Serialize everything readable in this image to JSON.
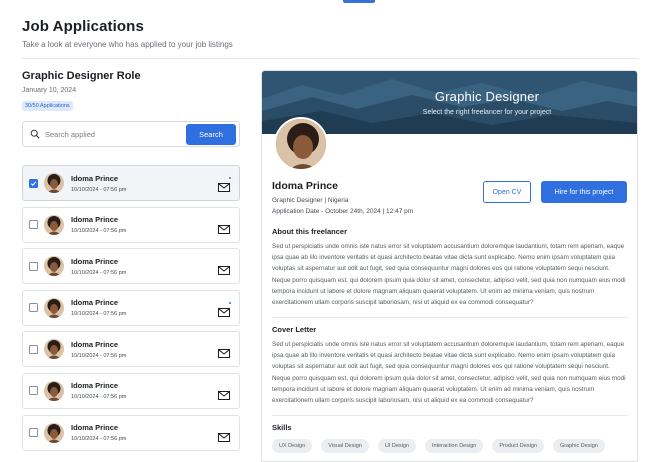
{
  "header": {
    "title": "Job Applications",
    "subtitle": "Take a look at everyone who has applied to your job listings"
  },
  "role": {
    "title": "Graphic Designer Role",
    "date": "January 10, 2024",
    "badge": "30/50 Applications"
  },
  "search": {
    "placeholder": "Search applied",
    "button_label": "Search",
    "icon": "search-icon"
  },
  "applicants": [
    {
      "name": "Idoma Prince",
      "date": "10/10/2024 - 07:56 pm",
      "checked": true,
      "unread": true,
      "selected": true
    },
    {
      "name": "Idoma Prince",
      "date": "10/10/2024 - 07:56 pm",
      "checked": false,
      "unread": false,
      "selected": false
    },
    {
      "name": "Idoma Prince",
      "date": "10/10/2024 - 07:56 pm",
      "checked": false,
      "unread": false,
      "selected": false
    },
    {
      "name": "Idoma Prince",
      "date": "10/10/2024 - 07:56 pm",
      "checked": false,
      "unread": true,
      "selected": false
    },
    {
      "name": "Idoma Prince",
      "date": "10/10/2024 - 07:56 pm",
      "checked": false,
      "unread": false,
      "selected": false
    },
    {
      "name": "Idoma Prince",
      "date": "10/10/2024 - 07:56 pm",
      "checked": false,
      "unread": false,
      "selected": false
    },
    {
      "name": "Idoma Prince",
      "date": "10/10/2024 - 07:56 pm",
      "checked": false,
      "unread": false,
      "selected": false
    }
  ],
  "detail": {
    "banner_title": "Graphic Designer",
    "banner_subtitle": "Select the right freelancer for your project",
    "name": "Idoma Prince",
    "role_location": "Graphic Designer | Nigeria",
    "application_date": "Application Date - October 24th, 2024 | 12:47 pm",
    "open_cv_label": "Open CV",
    "hire_label": "Hire for this project",
    "about_heading": "About this freelancer",
    "about_text": "Sed ut perspiciatis unde omnis iste natus error sit voluptatem accusantium doloremque laudantium, totam rem aperiam, eaque ipsa quae ab illo inventore veritatis et quasi architecto beatae vitae dicta sunt explicabo. Nemo enim ipsam voluptatem quia voluptas sit aspernatur aut odit aut fugit, sed quia consequuntur magni dolores eos qui ratione voluptatem sequi nesciunt. Neque porro quisquam est, qui dolorem ipsum quia dolor sit amet, consectetur, adipisci velit, sed quia non numquam eius modi tempora incidunt ut labore et dolore magnam aliquam quaerat voluptatem. Ut enim ad minima veniam, quis nostrum exercitationem ullam corporis suscipit laboriosam, nisi ut aliquid ex ea commodi consequatur?",
    "cover_heading": "Cover Letter",
    "cover_text": "Sed ut perspiciatis unde omnis iste natus error sit voluptatem accusantium doloremque laudantium, totam rem aperiam, eaque ipsa quae ab illo inventore veritatis et quasi architecto beatae vitae dicta sunt explicabo. Nemo enim ipsam voluptatem quia voluptas sit aspernatur aut odit aut fugit, sed quia consequuntur magni dolores eos qui ratione voluptatem sequi nesciunt. Neque porro quisquam est, qui dolorem ipsum quia dolor sit amet, consectetur, adipisci velit, sed quia non numquam eius modi tempora incidunt ut labore et dolore magnam aliquam quaerat voluptatem. Ut enim ad minima veniam, quis nostrum exercitationem ullam corporis suscipit laboriosam, nisi ut aliquid ex ea commodi consequatur?",
    "skills_heading": "Skills",
    "skills": [
      "UX Design",
      "Visual Design",
      "UI Design",
      "Interaction Design",
      "Product Design",
      "Graphic Design",
      "",
      "",
      ""
    ]
  },
  "colors": {
    "accent": "#2f6fe0",
    "banner": "#2b4f6a",
    "badge_bg": "#dce8fb"
  }
}
